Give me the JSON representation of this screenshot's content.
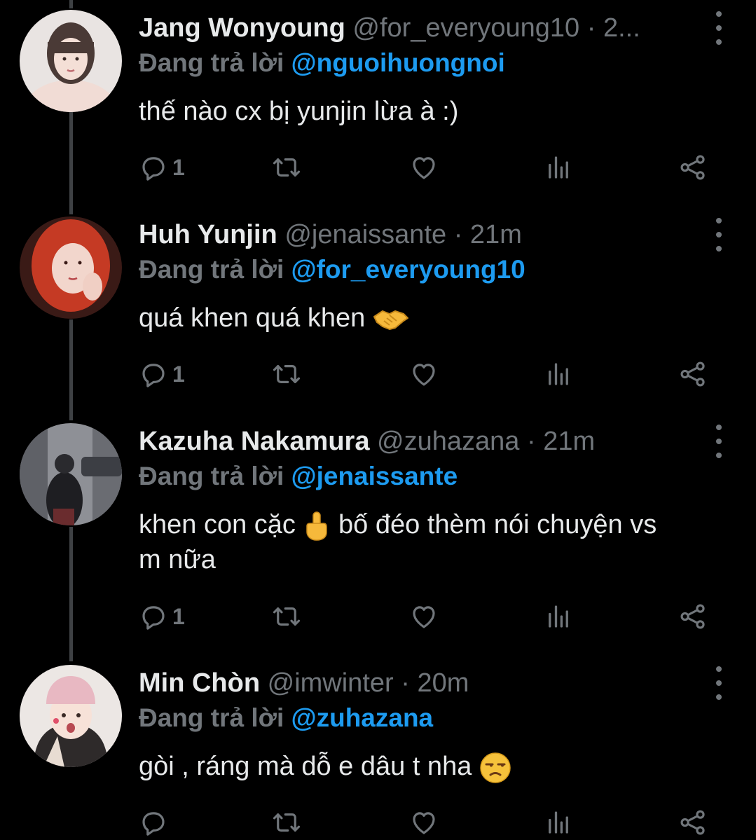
{
  "tweets": [
    {
      "name": "Jang Wonyoung",
      "handle": "@for_everyoung10",
      "time": "2...",
      "replying_prefix": "Đang trả lời",
      "replying_to": "@nguoihuongnoi",
      "text": "thế nào cx bị yunjin lừa à :)",
      "reply_count": "1",
      "avatar_color": "#c9a89a"
    },
    {
      "name": "Huh Yunjin",
      "handle": "@jenaissante",
      "time": "21m",
      "replying_prefix": "Đang trả lời",
      "replying_to": "@for_everyoung10",
      "text": "quá khen quá khen",
      "emoji": "handshake",
      "reply_count": "1",
      "avatar_color": "#d4402a"
    },
    {
      "name": "Kazuha Nakamura",
      "handle": "@zuhazana",
      "time": "21m",
      "replying_prefix": "Đang trả lời",
      "replying_to": "@jenaissante",
      "text_a": "khen con cặc",
      "emoji": "middle-finger",
      "text_b": "bố đéo thèm nói chuyện vs",
      "text_c": "m nữa",
      "reply_count": "1",
      "avatar_color": "#6c7077"
    },
    {
      "name": "Min Chòn",
      "handle": "@imwinter",
      "time": "20m",
      "replying_prefix": "Đang trả lời",
      "replying_to": "@zuhazana",
      "text": "gòi , ráng mà dỗ e dâu t nha",
      "emoji": "unamused-face",
      "reply_count": "",
      "avatar_color": "#e8c4c0"
    }
  ],
  "separator": "·",
  "icons": [
    "reply-icon",
    "retweet-icon",
    "like-icon",
    "views-icon",
    "share-icon",
    "more-icon"
  ],
  "colors": {
    "background": "#000000",
    "text": "#e7e9ea",
    "muted": "#71767b",
    "link": "#1d9bf0",
    "thread": "#3e4144"
  }
}
